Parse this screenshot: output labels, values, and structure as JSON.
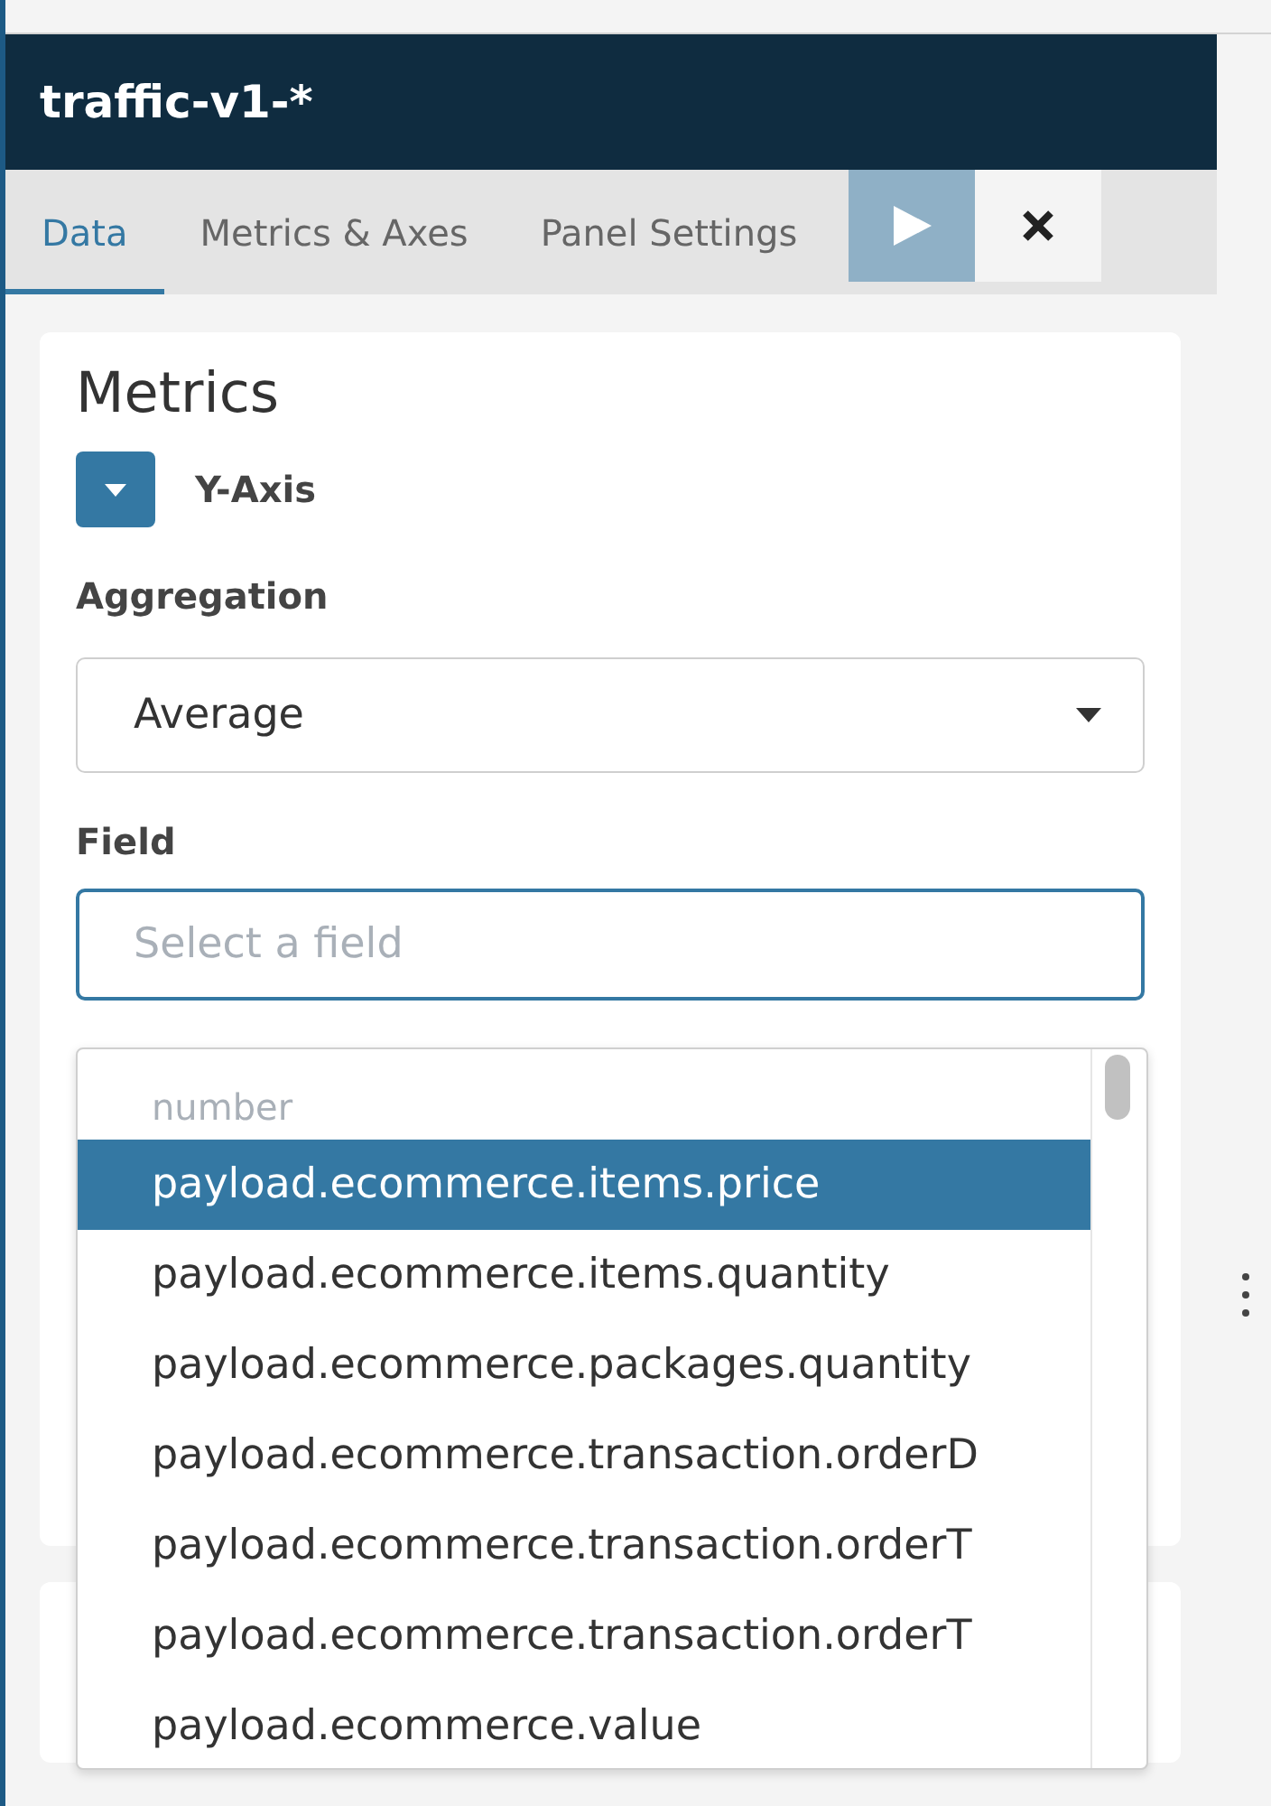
{
  "header": {
    "title": "traffic-v1-*"
  },
  "tabs": [
    {
      "label": "Data",
      "selected": true
    },
    {
      "label": "Metrics & Axes",
      "selected": false
    },
    {
      "label": "Panel Settings",
      "selected": false
    }
  ],
  "metrics": {
    "title": "Metrics",
    "y_axis": {
      "label": "Y-Axis",
      "expanded": true
    },
    "aggregation": {
      "label": "Aggregation",
      "value": "Average"
    },
    "field": {
      "label": "Field",
      "placeholder": "Select a field"
    }
  },
  "dropdown": {
    "group": "number",
    "options": [
      {
        "label": "payload.ecommerce.items.price",
        "selected": true
      },
      {
        "label": "payload.ecommerce.items.quantity",
        "selected": false
      },
      {
        "label": "payload.ecommerce.packages.quantity",
        "selected": false
      },
      {
        "label": "payload.ecommerce.transaction.orderD",
        "selected": false
      },
      {
        "label": "payload.ecommerce.transaction.orderT",
        "selected": false
      },
      {
        "label": "payload.ecommerce.transaction.orderT",
        "selected": false
      },
      {
        "label": "payload.ecommerce.value",
        "selected": false
      }
    ]
  }
}
